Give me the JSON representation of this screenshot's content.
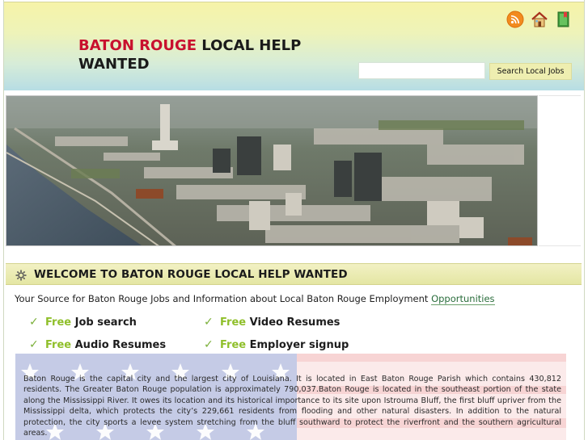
{
  "header": {
    "title_accent": "BATON ROUGE",
    "title_rest": "LOCAL HELP WANTED",
    "icons": [
      "rss-icon",
      "home-icon",
      "bookmark-icon"
    ]
  },
  "search": {
    "placeholder": "",
    "button_label": "Search Local Jobs"
  },
  "hero": {
    "image_subject": "aerial-city-view-baton-rouge"
  },
  "section": {
    "title": "WELCOME TO BATON ROUGE LOCAL HELP WANTED"
  },
  "intro": {
    "text": "Your Source for Baton Rouge Jobs and Information about Local Baton Rouge Employment",
    "link_text": "Opportunities"
  },
  "features": [
    {
      "free": "Free",
      "label": "Job search"
    },
    {
      "free": "Free",
      "label": "Video Resumes"
    },
    {
      "free": "Free",
      "label": "Audio Resumes"
    },
    {
      "free": "Free",
      "label": "Employer signup"
    }
  ],
  "about": {
    "text": "Baton Rouge is the capital city and the largest city of Louisiana. It is located in East Baton Rouge Parish which contains 430,812 residents. The Greater Baton Rouge population is approximately 790,037.Baton Rouge is located in the southeast portion of the state along the Mississippi River. It owes its location and its historical importance to its site upon Istrouma Bluff, the first bluff upriver from the Mississippi delta, which protects the city’s 229,661 residents from flooding and other natural disasters. In addition to the natural protection, the city sports a levee system stretching from the bluff southward to protect the riverfront and the southern agricultural areas."
  },
  "colors": {
    "title_accent": "#c8102e",
    "free_accent": "#8fbf2a",
    "check": "#7bb03a",
    "section_bar": "#e4e6a3"
  }
}
